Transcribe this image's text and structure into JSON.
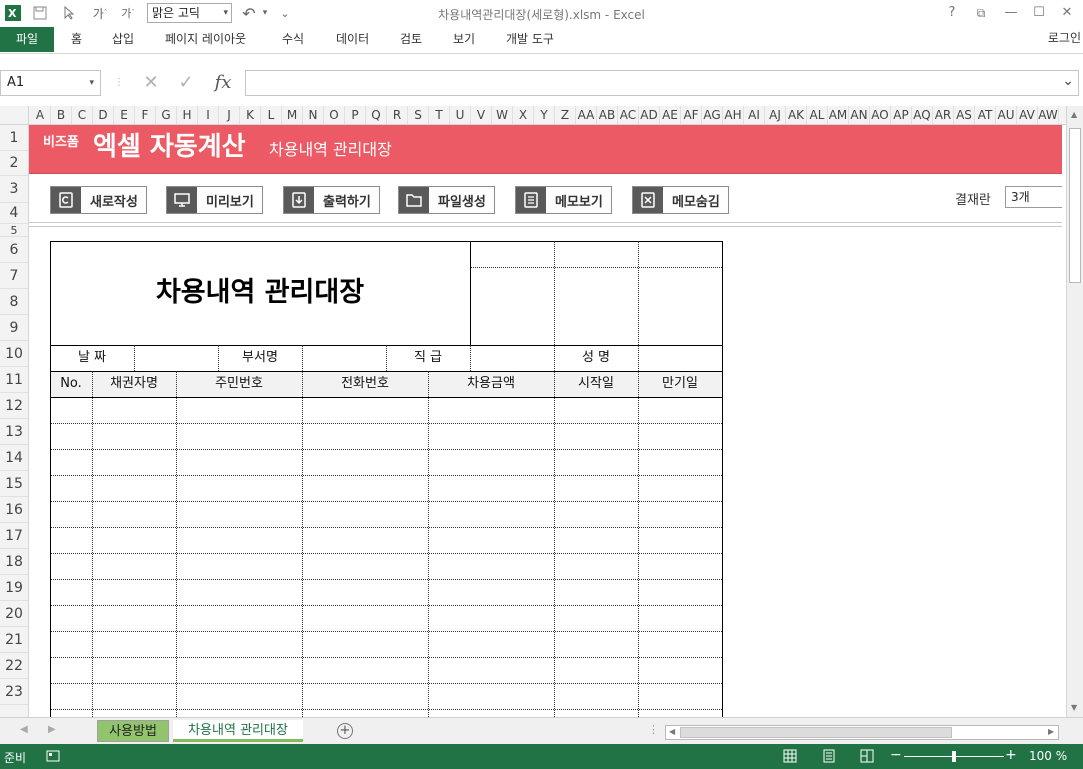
{
  "window": {
    "title": "차용내역관리대장(세로형).xlsm - Excel",
    "font_name": "맑은 고딕",
    "help": "?",
    "restore": "⧉",
    "minimize": "—",
    "maximize": "☐",
    "close": "✕"
  },
  "quick_access": {
    "undo_arrow": "↶",
    "qa_menu": "⌄",
    "font_dropdown_arrow": "▾"
  },
  "ribbon": {
    "file": "파일",
    "tabs": [
      "홈",
      "삽입",
      "페이지 레이아웃",
      "수식",
      "데이터",
      "검토",
      "보기",
      "개발 도구"
    ],
    "login": "로그인"
  },
  "formula_bar": {
    "name_box": "A1",
    "name_dropdown": "▾",
    "cancel": "✕",
    "enter": "✓",
    "fx": "fx",
    "value": "",
    "expand": "⌄"
  },
  "columns": [
    "A",
    "B",
    "C",
    "D",
    "E",
    "F",
    "G",
    "H",
    "I",
    "J",
    "K",
    "L",
    "M",
    "N",
    "O",
    "P",
    "Q",
    "R",
    "S",
    "T",
    "U",
    "V",
    "W",
    "X",
    "Y",
    "Z",
    "AA",
    "AB",
    "AC",
    "AD",
    "AE",
    "AF",
    "AG",
    "AH",
    "AI",
    "AJ",
    "AK",
    "AL",
    "AM",
    "AN",
    "AO",
    "AP",
    "AQ",
    "AR",
    "AS",
    "AT",
    "AU",
    "AV",
    "AW"
  ],
  "rows": [
    "1",
    "2",
    "3",
    "4",
    "5",
    "6",
    "7",
    "8",
    "9",
    "10",
    "11",
    "12",
    "13",
    "14",
    "15",
    "16",
    "17",
    "18",
    "19",
    "20",
    "21",
    "22",
    "23"
  ],
  "banner": {
    "logo": "비즈폼",
    "title": "엑셀 자동계산",
    "subtitle": "차용내역 관리대장"
  },
  "toolbar": {
    "buttons": [
      {
        "label": "새로작성",
        "icon": "new-doc-icon"
      },
      {
        "label": "미리보기",
        "icon": "monitor-icon"
      },
      {
        "label": "출력하기",
        "icon": "print-icon"
      },
      {
        "label": "파일생성",
        "icon": "folder-icon"
      },
      {
        "label": "메모보기",
        "icon": "memo-icon"
      },
      {
        "label": "메모숨김",
        "icon": "memo-hide-icon"
      }
    ],
    "approval_label": "결재란",
    "approval_value": "3개"
  },
  "form": {
    "title": "차용내역 관리대장",
    "info_labels": [
      "날  짜",
      "부서명",
      "직  급",
      "성  명"
    ],
    "headers": [
      "No.",
      "채권자명",
      "주민번호",
      "전화번호",
      "차용금액",
      "시작일",
      "만기일"
    ]
  },
  "sheet_tabs": {
    "tabs": [
      "사용방법",
      "차용내역 관리대장"
    ],
    "active": 1,
    "add": "+",
    "prev": "◀",
    "next": "▶",
    "scroll_left": "◀",
    "scroll_right": "▶"
  },
  "status_bar": {
    "status": "준비",
    "zoom": "100 %",
    "zoom_minus": "−",
    "zoom_plus": "+",
    "zoom_fraction": 0.5
  },
  "colors": {
    "excel_green": "#217346",
    "banner": "#ec5b65",
    "active_tab_underline": "#86b95a"
  }
}
